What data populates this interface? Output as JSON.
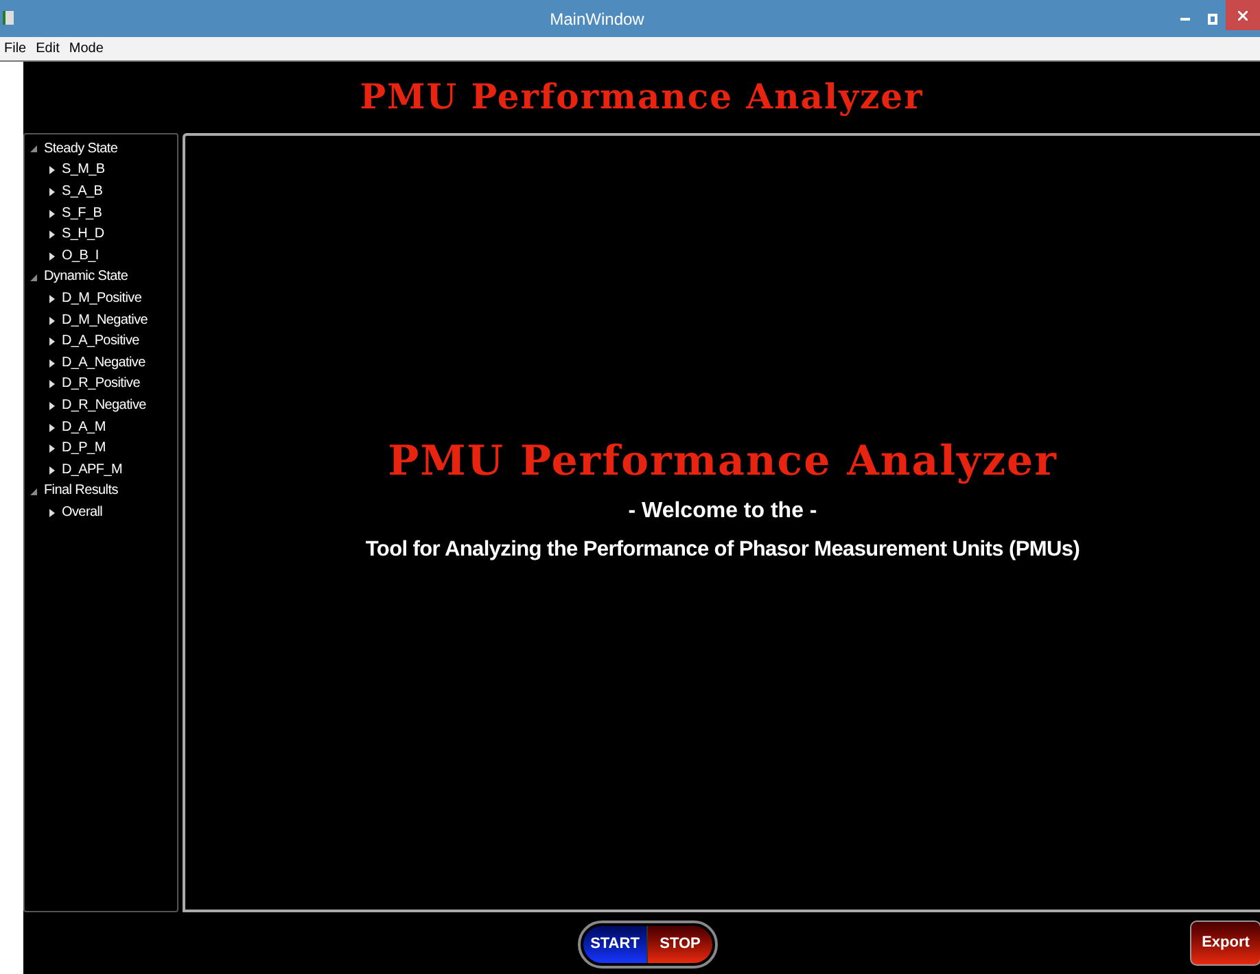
{
  "window": {
    "title": "MainWindow"
  },
  "menu": [
    "File",
    "Edit",
    "Mode"
  ],
  "header": {
    "title": "PMU Performance Analyzer"
  },
  "tree": [
    {
      "label": "Steady State",
      "expanded": true,
      "children": [
        {
          "label": "S_M_B",
          "expanded": false
        },
        {
          "label": "S_A_B",
          "expanded": false
        },
        {
          "label": "S_F_B",
          "expanded": false
        },
        {
          "label": "S_H_D",
          "expanded": false
        },
        {
          "label": "O_B_I",
          "expanded": false
        }
      ]
    },
    {
      "label": "Dynamic State",
      "expanded": true,
      "children": [
        {
          "label": "D_M_Positive",
          "expanded": false
        },
        {
          "label": "D_M_Negative",
          "expanded": false
        },
        {
          "label": "D_A_Positive",
          "expanded": false
        },
        {
          "label": "D_A_Negative",
          "expanded": false
        },
        {
          "label": "D_R_Positive",
          "expanded": false
        },
        {
          "label": "D_R_Negative",
          "expanded": false
        },
        {
          "label": "D_A_M",
          "expanded": false
        },
        {
          "label": "D_P_M",
          "expanded": false
        },
        {
          "label": "D_APF_M",
          "expanded": false
        }
      ]
    },
    {
      "label": "Final Results",
      "expanded": true,
      "children": [
        {
          "label": "Overall",
          "expanded": false
        }
      ]
    }
  ],
  "welcome": {
    "title": "PMU Performance Analyzer",
    "subtitle": "- Welcome to the -",
    "description": "Tool for Analyzing the Performance of Phasor Measurement Units (PMUs)"
  },
  "buttons": {
    "start": "START",
    "stop": "STOP",
    "export": "Export"
  }
}
